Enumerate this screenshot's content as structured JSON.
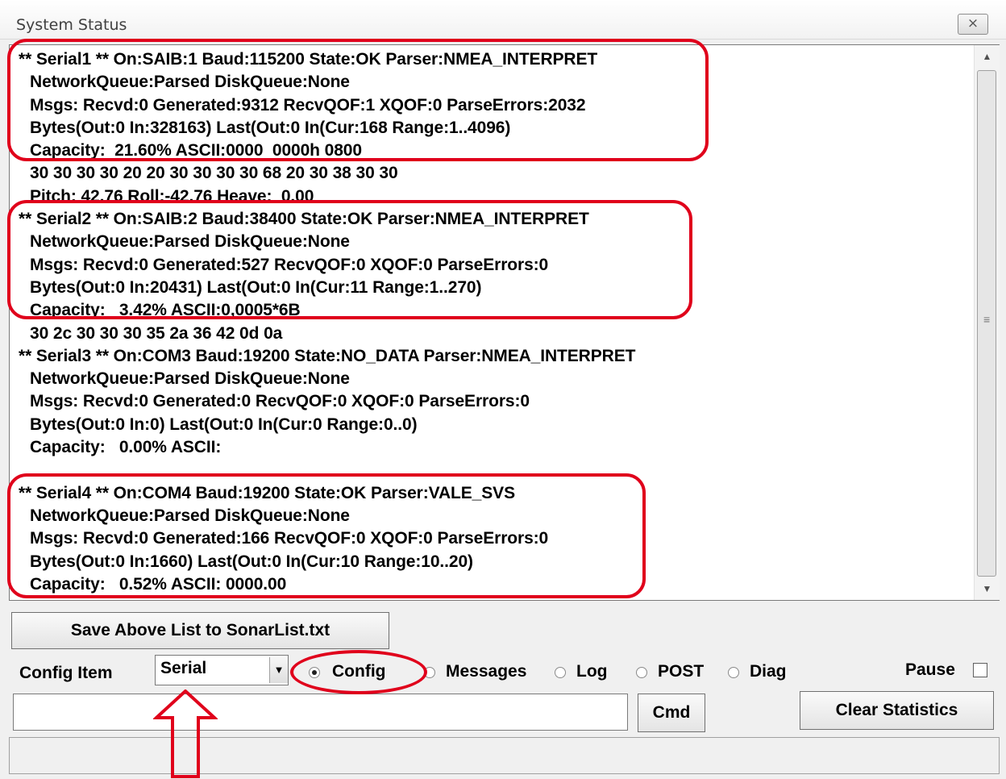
{
  "window": {
    "title": "System Status",
    "close_glyph": "⨯"
  },
  "status_list": {
    "lines": [
      "** Serial1 ** On:SAIB:1 Baud:115200 State:OK Parser:NMEA_INTERPRET",
      "NetworkQueue:Parsed DiskQueue:None",
      "Msgs: Recvd:0 Generated:9312 RecvQOF:1 XQOF:0 ParseErrors:2032",
      "Bytes(Out:0 In:328163) Last(Out:0 In(Cur:168 Range:1..4096)",
      "Capacity:  21.60% ASCII:0000  0000h 0800",
      "30 30 30 30 20 20 30 30 30 30 68 20 30 38 30 30",
      "Pitch: 42.76 Roll:-42.76 Heave:  0.00",
      "** Serial2 ** On:SAIB:2 Baud:38400 State:OK Parser:NMEA_INTERPRET",
      "NetworkQueue:Parsed DiskQueue:None",
      "Msgs: Recvd:0 Generated:527 RecvQOF:0 XQOF:0 ParseErrors:0",
      "Bytes(Out:0 In:20431) Last(Out:0 In(Cur:11 Range:1..270)",
      "Capacity:   3.42% ASCII:0,0005*6B",
      "30 2c 30 30 30 35 2a 36 42 0d 0a",
      "** Serial3 ** On:COM3 Baud:19200 State:NO_DATA Parser:NMEA_INTERPRET",
      "NetworkQueue:Parsed DiskQueue:None",
      "Msgs: Recvd:0 Generated:0 RecvQOF:0 XQOF:0 ParseErrors:0",
      "Bytes(Out:0 In:0) Last(Out:0 In(Cur:0 Range:0..0)",
      "Capacity:   0.00% ASCII:",
      "",
      "** Serial4 ** On:COM4 Baud:19200 State:OK Parser:VALE_SVS",
      "NetworkQueue:Parsed DiskQueue:None",
      "Msgs: Recvd:0 Generated:166 RecvQOF:0 XQOF:0 ParseErrors:0",
      "Bytes(Out:0 In:1660) Last(Out:0 In(Cur:10 Range:10..20)",
      "Capacity:   0.52% ASCII: 0000.00"
    ]
  },
  "buttons": {
    "save_list": "Save Above List to SonarList.txt",
    "cmd": "Cmd",
    "clear_statistics": "Clear Statistics"
  },
  "config": {
    "item_label": "Config Item",
    "selected_item": "Serial",
    "radios": [
      {
        "label": "Config",
        "selected": true
      },
      {
        "label": "Messages",
        "selected": false
      },
      {
        "label": "Log",
        "selected": false
      },
      {
        "label": "POST",
        "selected": false
      },
      {
        "label": "Diag",
        "selected": false
      }
    ],
    "pause_label": "Pause",
    "pause_checked": false
  },
  "command_input": {
    "value": ""
  },
  "colors": {
    "annotation": "#e0001b"
  }
}
